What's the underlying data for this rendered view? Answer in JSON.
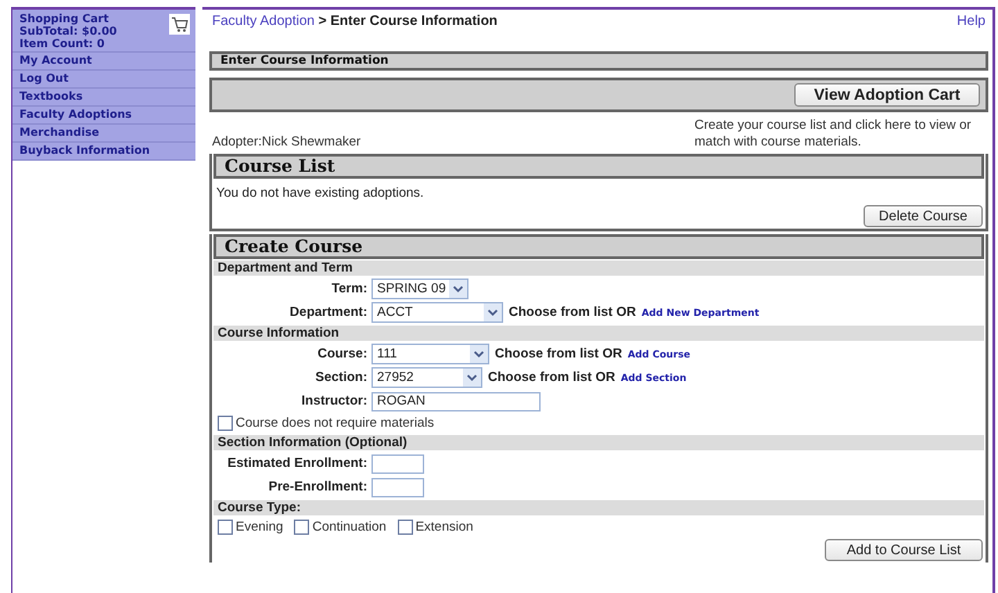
{
  "sidebar": {
    "cart": {
      "title": "Shopping Cart",
      "subtotal": "SubTotal: $0.00",
      "item_count": "Item Count: 0"
    },
    "items": [
      {
        "label": "My Account"
      },
      {
        "label": "Log Out"
      },
      {
        "label": "Textbooks"
      },
      {
        "label": "Faculty Adoptions"
      },
      {
        "label": "Merchandise"
      },
      {
        "label": "Buyback Information"
      }
    ]
  },
  "breadcrumb": {
    "link": "Faculty Adoption",
    "separator": ">",
    "current": "Enter Course Information"
  },
  "help_link": "Help",
  "section_title": "Enter Course Information",
  "view_cart_button": "View Adoption Cart",
  "adopter": "Adopter:Nick Shewmaker",
  "cart_note": "Create your course list and click here to view or match with course materials.",
  "course_list": {
    "title": "Course List",
    "message": "You do not have existing adoptions.",
    "delete_button": "Delete Course"
  },
  "create_course": {
    "title": "Create Course",
    "groups": [
      {
        "title": "Department and Term",
        "rows": [
          {
            "kind": "select",
            "label": "Term:",
            "value": "SPRING 09"
          },
          {
            "kind": "select",
            "label": "Department:",
            "value": "ACCT",
            "hint": "Choose from list OR",
            "link": "Add New Department"
          }
        ]
      },
      {
        "title": "Course Information",
        "rows": [
          {
            "kind": "select",
            "label": "Course:",
            "value": "111",
            "hint": "Choose from list OR",
            "link": "Add Course"
          },
          {
            "kind": "select",
            "label": "Section:",
            "value": "27952",
            "hint": "Choose from list OR",
            "link": "Add Section"
          },
          {
            "kind": "text",
            "label": "Instructor:",
            "value": "ROGAN"
          },
          {
            "kind": "checkbox",
            "label": "Course does not require materials",
            "checked": false
          }
        ]
      },
      {
        "title": "Section Information (Optional)",
        "rows": [
          {
            "kind": "number",
            "label": "Estimated Enrollment:"
          },
          {
            "kind": "number",
            "label": "Pre-Enrollment:"
          }
        ]
      },
      {
        "title": "Course Type:",
        "rows": [
          {
            "kind": "checks",
            "options": [
              {
                "label": "Evening",
                "checked": false
              },
              {
                "label": "Continuation",
                "checked": false
              },
              {
                "label": "Extension",
                "checked": false
              }
            ]
          }
        ]
      }
    ],
    "add_button": "Add to Course List"
  }
}
